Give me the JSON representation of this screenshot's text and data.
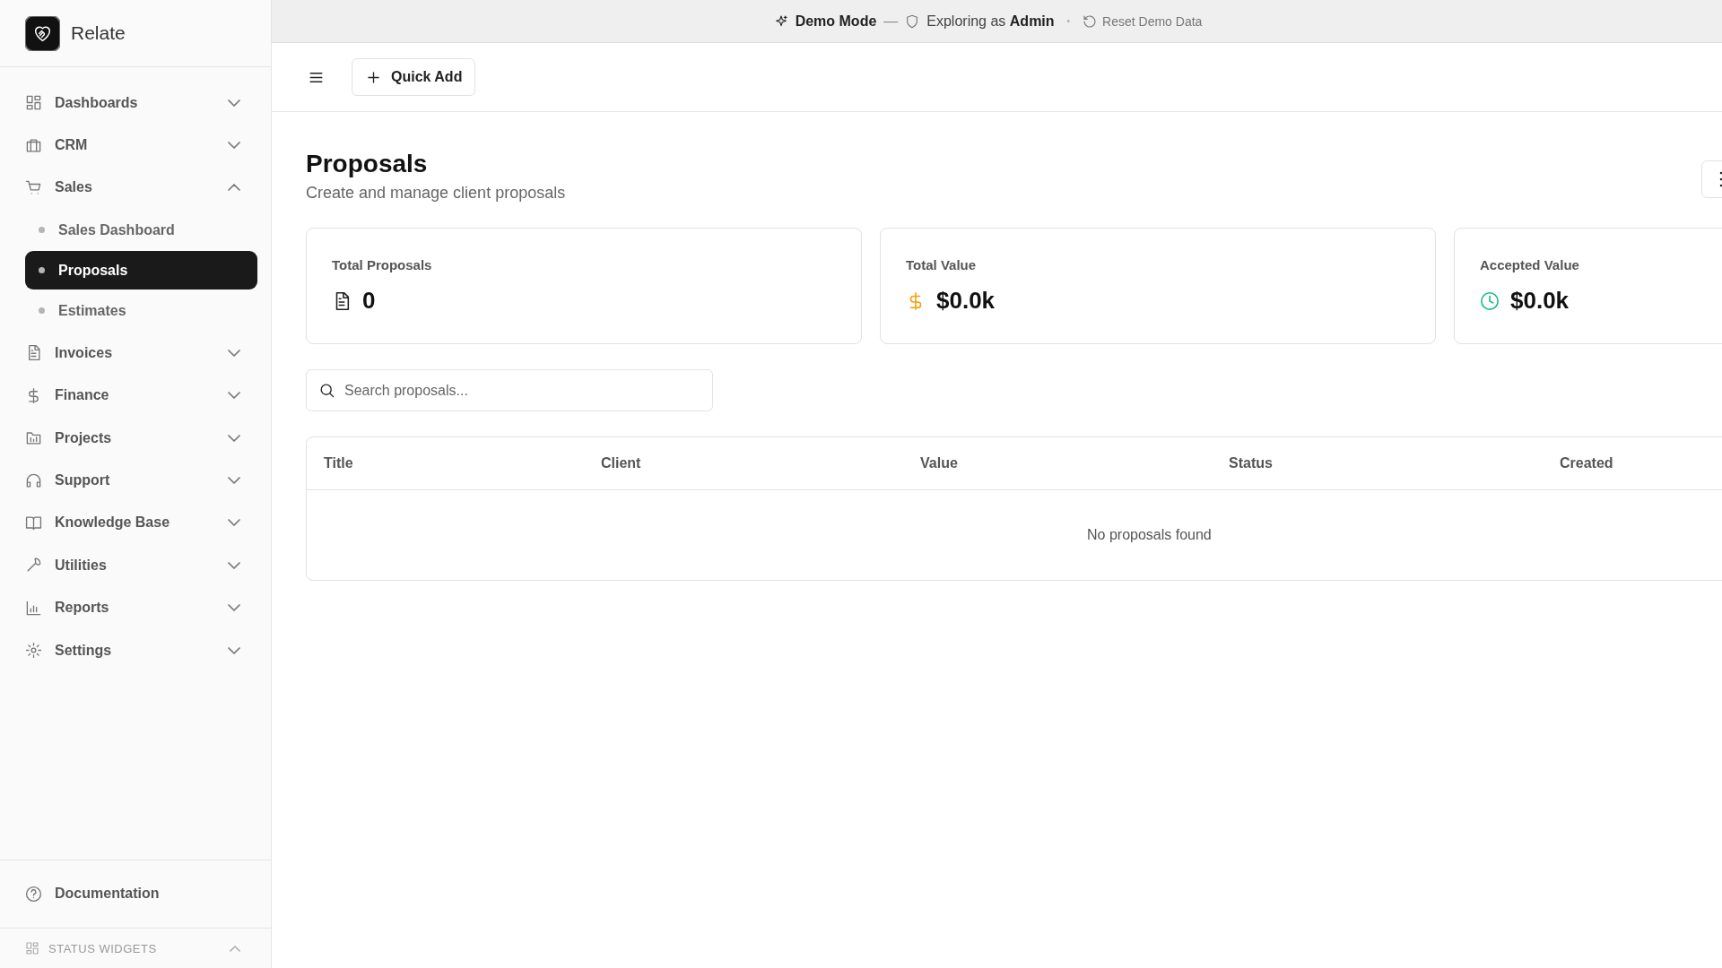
{
  "app": {
    "name": "Relate"
  },
  "banner": {
    "mode": "Demo Mode",
    "separator": "—",
    "role_text": "Exploring as **Admin**",
    "dot": "•",
    "reset": "Reset Demo Data"
  },
  "sidebar": {
    "items": [
      {
        "label": "Dashboards",
        "expanded": false
      },
      {
        "label": "CRM",
        "expanded": false
      },
      {
        "label": "Sales",
        "expanded": true,
        "children": [
          {
            "label": "Sales Dashboard",
            "selected": false
          },
          {
            "label": "Proposals",
            "selected": true
          },
          {
            "label": "Estimates",
            "selected": false
          }
        ]
      },
      {
        "label": "Invoices",
        "expanded": false
      },
      {
        "label": "Finance",
        "expanded": false
      },
      {
        "label": "Projects",
        "expanded": false
      },
      {
        "label": "Support",
        "expanded": false
      },
      {
        "label": "Knowledge Base",
        "expanded": false
      },
      {
        "label": "Utilities",
        "expanded": false
      },
      {
        "label": "Reports",
        "expanded": false
      },
      {
        "label": "Settings",
        "expanded": false
      }
    ],
    "footer_link": "Documentation",
    "widgets": {
      "label": "STATUS WIDGETS",
      "expanded": true
    }
  },
  "toolbar": {
    "quick_add": "Quick Add"
  },
  "page": {
    "title": "Proposals",
    "subtitle": "Create and manage client proposals"
  },
  "stats": [
    {
      "label": "Total Proposals",
      "value": "0",
      "color": "#1f1f1f"
    },
    {
      "label": "Total Value",
      "value": "$0.0k",
      "color": "#f59e0b"
    },
    {
      "label": "Accepted Value",
      "value": "$0.0k",
      "color": "#10b981"
    }
  ],
  "search": {
    "placeholder": "Search proposals..."
  },
  "table": {
    "columns": [
      "Title",
      "Client",
      "Value",
      "Status",
      "Created"
    ],
    "empty": "No proposals found"
  }
}
